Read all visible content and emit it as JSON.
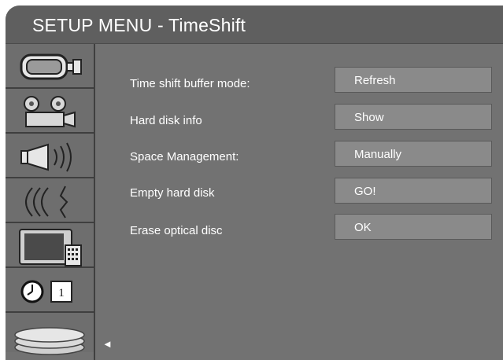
{
  "title": "SETUP MENU - TimeShift",
  "sidebar": {
    "items": [
      {
        "icon": "camcorder-icon"
      },
      {
        "icon": "film-projector-icon"
      },
      {
        "icon": "speaker-icon"
      },
      {
        "icon": "signal-waves-icon"
      },
      {
        "icon": "tv-remote-icon"
      },
      {
        "icon": "clock-icon",
        "badge": "1"
      },
      {
        "icon": "disc-stack-icon"
      }
    ],
    "selected_arrow": "◄"
  },
  "options": [
    {
      "label": "Time shift buffer mode:",
      "value": "Refresh"
    },
    {
      "label": "Hard disk info",
      "value": "Show"
    },
    {
      "label": "Space Management:",
      "value": "Manually"
    },
    {
      "label": "Empty hard disk",
      "value": "GO!"
    },
    {
      "label": "Erase optical disc",
      "value": "OK"
    }
  ],
  "colors": {
    "background": "#727272",
    "titlebar": "#5f5f5f",
    "value_box": "#8a8a8a",
    "text": "#ffffff"
  }
}
